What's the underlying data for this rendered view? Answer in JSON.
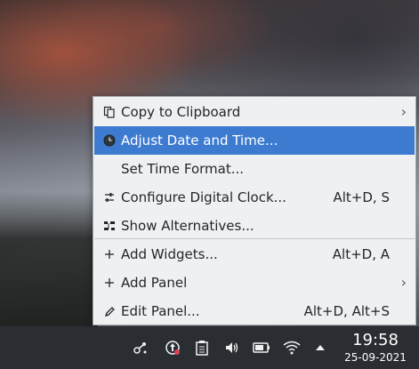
{
  "menu": {
    "items": [
      {
        "label": "Copy to Clipboard",
        "shortcut": "",
        "submenu": true,
        "icon": "clipboard-icon"
      },
      {
        "label": "Adjust Date and Time...",
        "shortcut": "",
        "submenu": false,
        "icon": "clock-icon"
      },
      {
        "label": "Set Time Format...",
        "shortcut": "",
        "submenu": false,
        "icon": ""
      },
      {
        "label": "Configure Digital Clock...",
        "shortcut": "Alt+D, S",
        "submenu": false,
        "icon": "configure-icon"
      },
      {
        "label": "Show Alternatives...",
        "shortcut": "",
        "submenu": false,
        "icon": "alternatives-icon"
      },
      {
        "label": "Add Widgets...",
        "shortcut": "Alt+D, A",
        "submenu": false,
        "icon": "plus-icon"
      },
      {
        "label": "Add Panel",
        "shortcut": "",
        "submenu": true,
        "icon": "plus-icon"
      },
      {
        "label": "Edit Panel...",
        "shortcut": "Alt+D, Alt+S",
        "submenu": false,
        "icon": "pencil-icon"
      }
    ],
    "highlighted_index": 1,
    "highlight_color": "#3d7bd0"
  },
  "panel": {
    "clock_time": "19:58",
    "clock_date": "25-09-2021",
    "background": "#2a2e32",
    "tray_icons": [
      "kde-connect-icon",
      "updates-icon",
      "clipboard-tray-icon",
      "volume-icon",
      "battery-icon",
      "wifi-icon",
      "expand-tray-icon"
    ]
  }
}
